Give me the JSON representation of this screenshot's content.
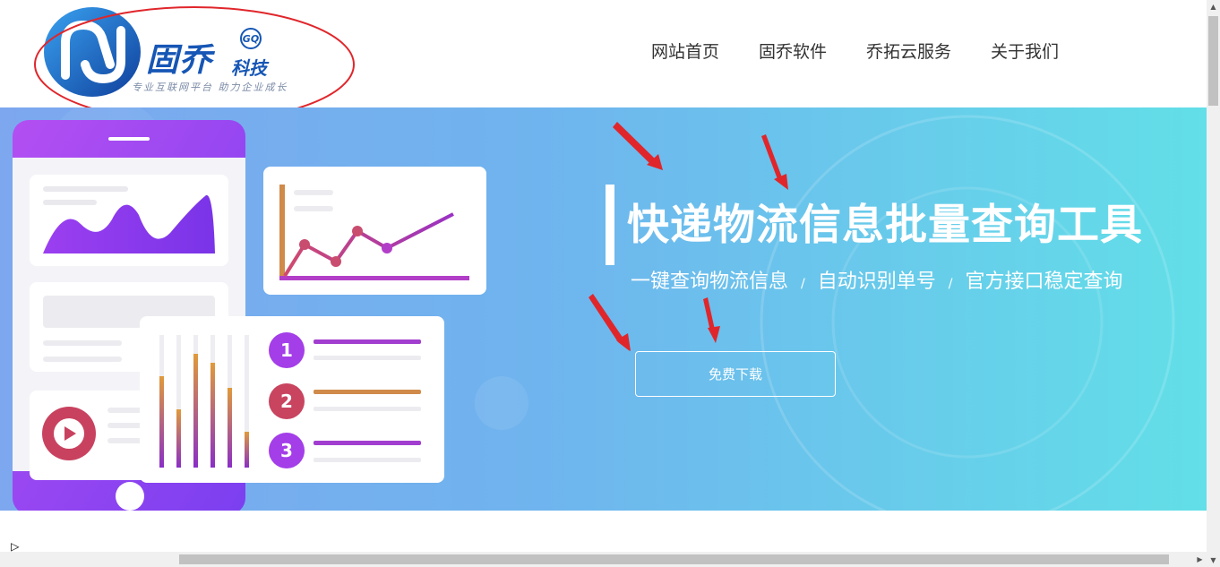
{
  "logo": {
    "name": "固乔",
    "name_sub": "科技",
    "badge": "GQ",
    "slogan": "专业互联网平台 助力企业成长"
  },
  "nav": {
    "items": [
      "网站首页",
      "固乔软件",
      "乔拓云服务",
      "关于我们"
    ]
  },
  "banner": {
    "headline": "快递物流信息批量查询工具",
    "sub_parts": [
      "一键查询物流信息",
      "自动识别单号",
      "官方接口稳定查询"
    ],
    "separator": "/",
    "button_label": "免费下载",
    "list_numbers": [
      "1",
      "2",
      "3"
    ]
  },
  "colors": {
    "annotation_red": "#e0262b",
    "logo_blue": "#1656b5",
    "banner_start": "#7da7ef",
    "banner_end": "#62dfe8"
  },
  "scroll": {
    "corner_icon": "▷"
  }
}
